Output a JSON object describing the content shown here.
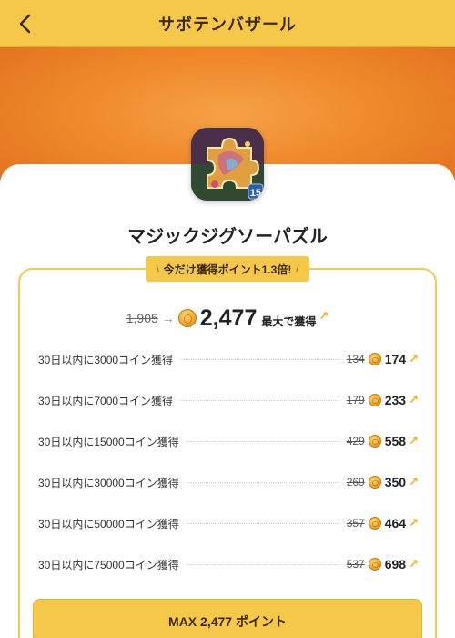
{
  "header": {
    "title": "サボテンバザール"
  },
  "app": {
    "name": "マジックジグソーパズル",
    "icon_badge": "15"
  },
  "promo": {
    "tag_text": "今だけ獲得ポイント1.3倍!"
  },
  "totals": {
    "old": "1,905",
    "new": "2,477",
    "max_label": "最大で獲得"
  },
  "rewards": [
    {
      "label": "30日以内に3000コイン獲得",
      "old": "134",
      "new": "174"
    },
    {
      "label": "30日以内に7000コイン獲得",
      "old": "179",
      "new": "233"
    },
    {
      "label": "30日以内に15000コイン獲得",
      "old": "429",
      "new": "558"
    },
    {
      "label": "30日以内に30000コイン獲得",
      "old": "269",
      "new": "350"
    },
    {
      "label": "30日以内に50000コイン獲得",
      "old": "357",
      "new": "464"
    },
    {
      "label": "30日以内に75000コイン獲得",
      "old": "537",
      "new": "698"
    }
  ],
  "button": {
    "label": "MAX 2,477 ポイント"
  },
  "icons": {
    "back": "chevron-left-icon",
    "coin": "coin-icon",
    "up": "arrow-up-right-icon"
  },
  "colors": {
    "accent": "#f6c84a",
    "banner": "#ef8a2c",
    "box_border": "#f3c957"
  }
}
